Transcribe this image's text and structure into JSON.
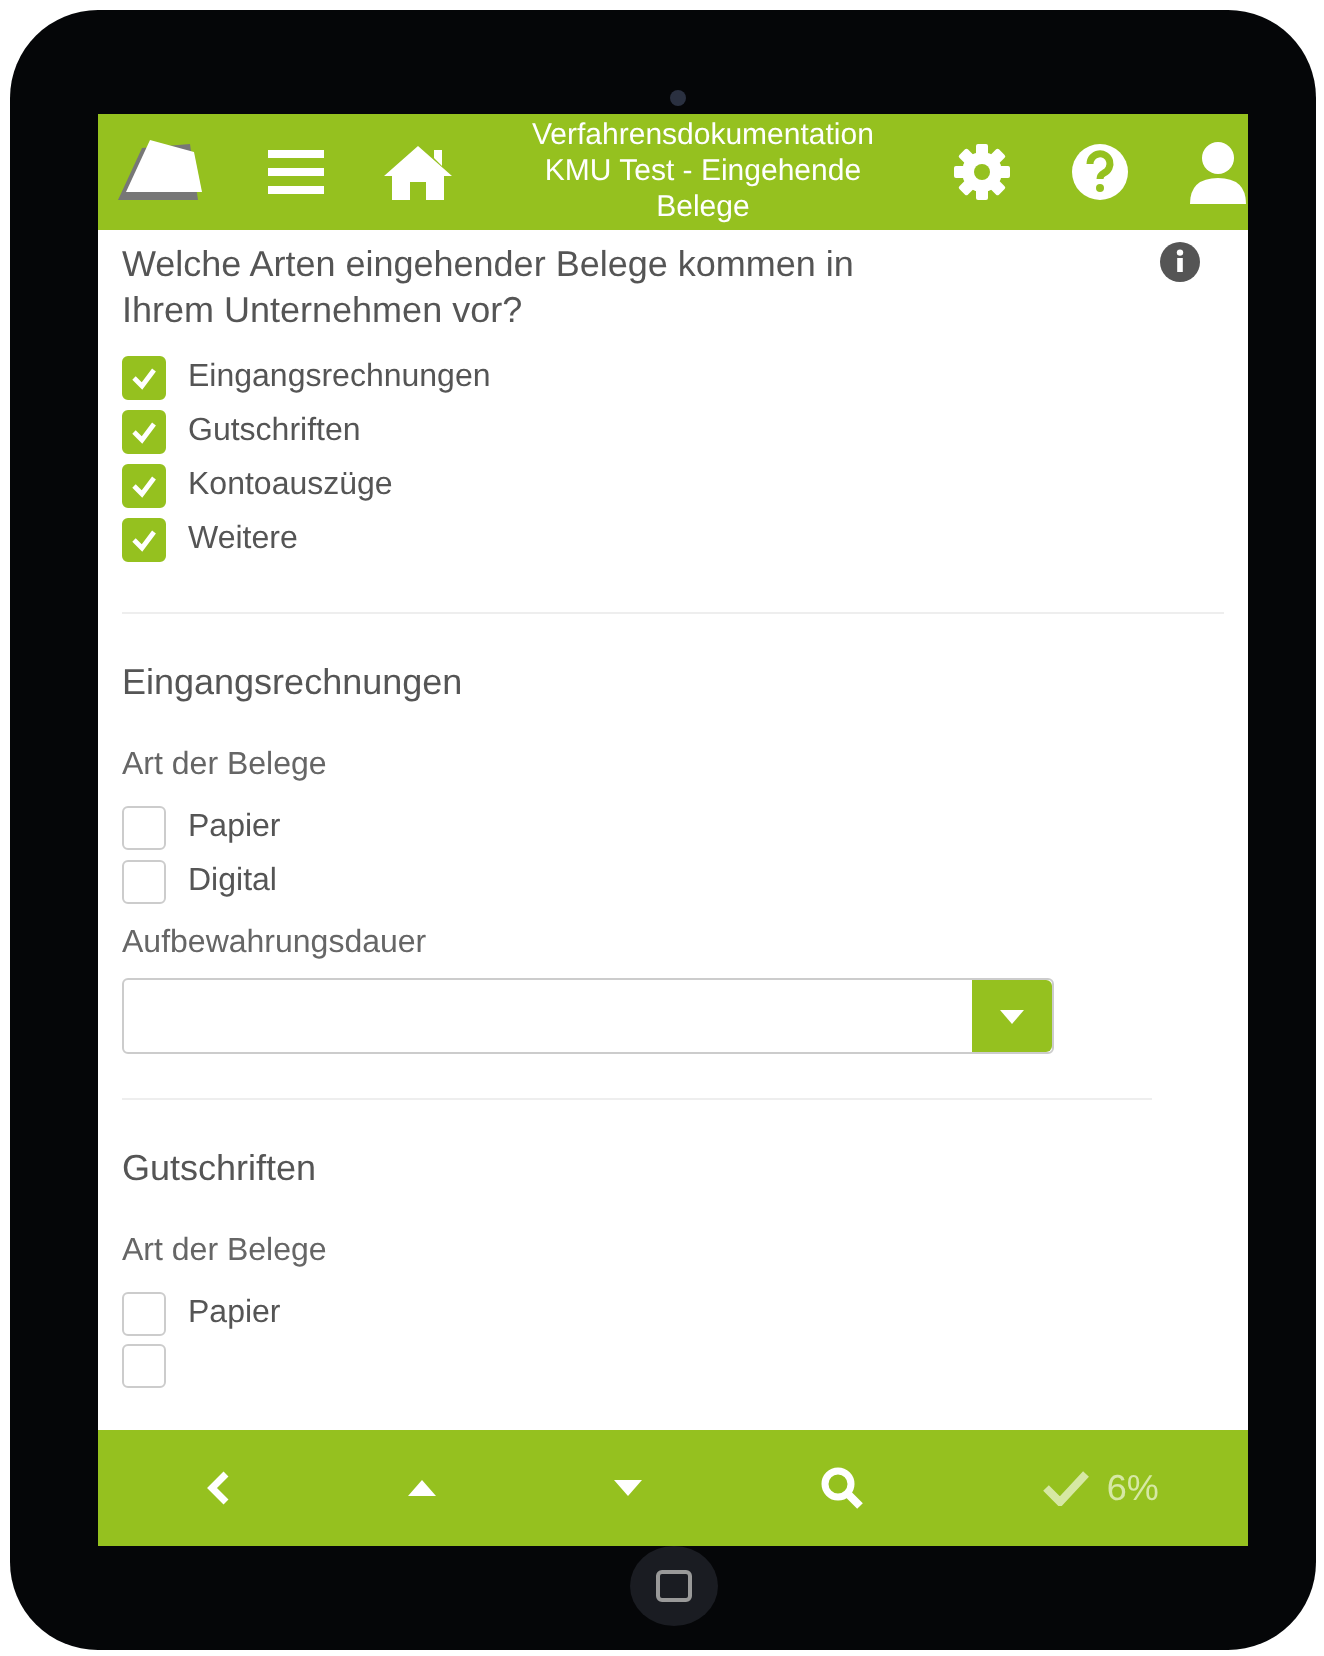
{
  "header": {
    "title": "Verfahrensdokumentation KMU Test - Eingehende Belege"
  },
  "question": {
    "text": "Welche Arten eingehender Belege kommen in Ihrem Unternehmen vor?",
    "options": [
      {
        "label": "Eingangsrechnungen",
        "checked": true
      },
      {
        "label": "Gutschriften",
        "checked": true
      },
      {
        "label": "Kontoauszüge",
        "checked": true
      },
      {
        "label": "Weitere",
        "checked": true
      }
    ]
  },
  "sections": [
    {
      "title": "Eingangsrechnungen",
      "type_label": "Art der Belege",
      "options": [
        {
          "label": "Papier",
          "checked": false
        },
        {
          "label": "Digital",
          "checked": false
        }
      ],
      "retention_label": "Aufbewahrungsdauer"
    },
    {
      "title": "Gutschriften",
      "type_label": "Art der Belege",
      "options": [
        {
          "label": "Papier",
          "checked": false
        }
      ],
      "partial_option": {
        "checked": false
      }
    }
  ],
  "footer": {
    "progress": "6%"
  }
}
